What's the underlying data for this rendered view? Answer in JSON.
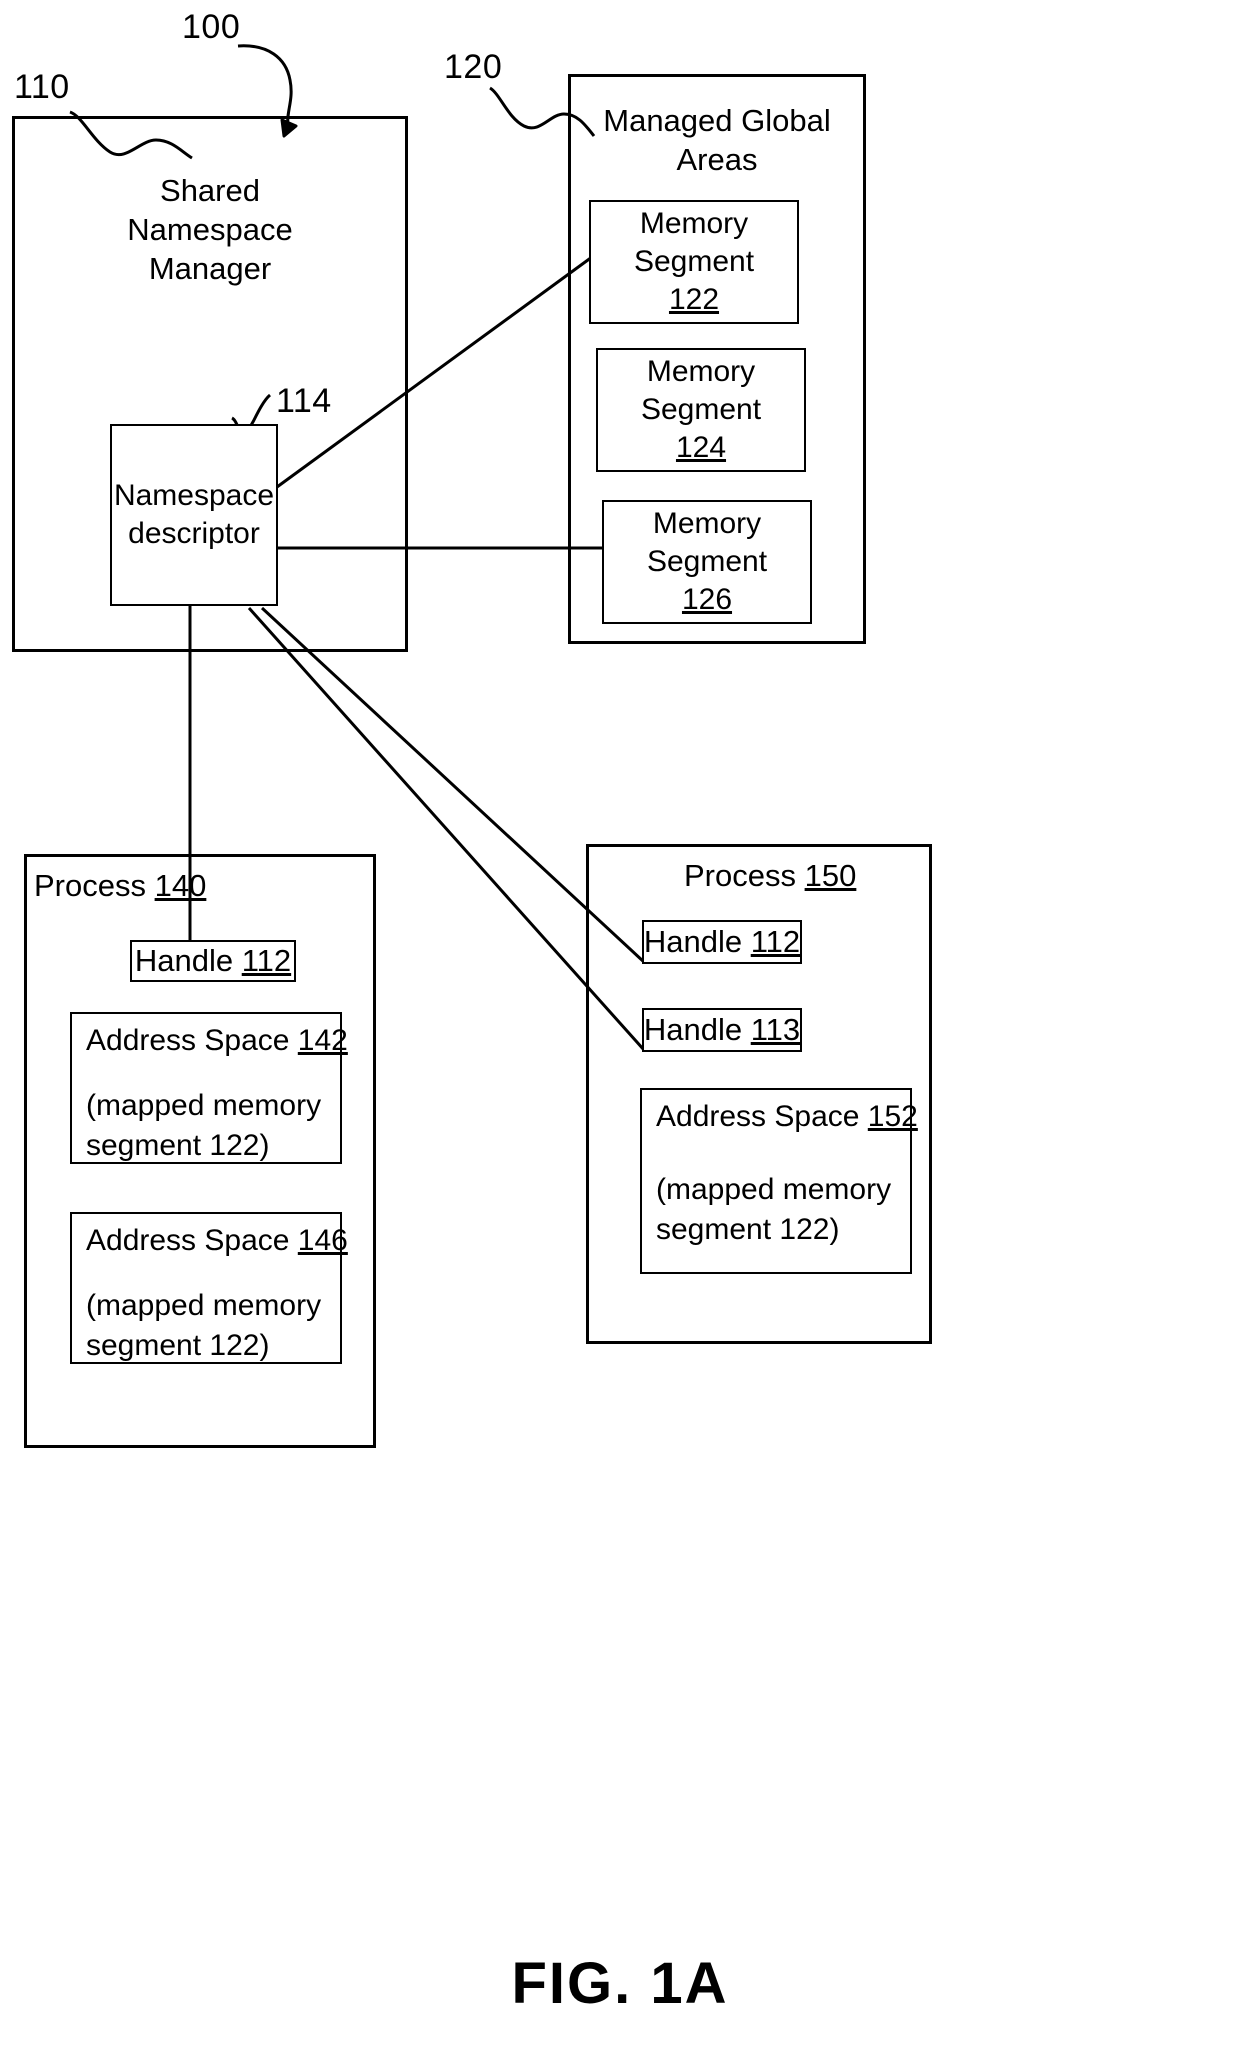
{
  "figure": {
    "caption": "FIG. 1A",
    "system_ref": "100"
  },
  "snm": {
    "ref": "110",
    "title_line1": "Shared",
    "title_line2": "Namespace",
    "title_line3": "Manager",
    "descriptor": {
      "ref": "114",
      "line1": "Namespace",
      "line2": "descriptor"
    }
  },
  "mga": {
    "ref": "120",
    "title_line1": "Managed Global",
    "title_line2": "Areas",
    "segments": [
      {
        "line1": "Memory",
        "line2": "Segment",
        "ref": "122"
      },
      {
        "line1": "Memory",
        "line2": "Segment",
        "ref": "124"
      },
      {
        "line1": "Memory",
        "line2": "Segment",
        "ref": "126"
      }
    ]
  },
  "process140": {
    "title_label": "Process ",
    "title_ref": "140",
    "handles": [
      {
        "label": "Handle ",
        "ref": "112"
      }
    ],
    "address_spaces": [
      {
        "label": "Address Space ",
        "ref": "142",
        "sub_line1": "(mapped memory",
        "sub_line2": "segment 122)"
      },
      {
        "label": "Address Space ",
        "ref": "146",
        "sub_line1": "(mapped memory",
        "sub_line2": "segment 122)"
      }
    ]
  },
  "process150": {
    "title_label": "Process ",
    "title_ref": "150",
    "handles": [
      {
        "label": "Handle ",
        "ref": "112"
      },
      {
        "label": "Handle ",
        "ref": "113"
      }
    ],
    "address_spaces": [
      {
        "label": "Address Space ",
        "ref": "152",
        "sub_line1": "(mapped memory",
        "sub_line2": "segment 122)"
      }
    ]
  },
  "colors": {
    "stroke": "#000000",
    "background": "#ffffff"
  }
}
